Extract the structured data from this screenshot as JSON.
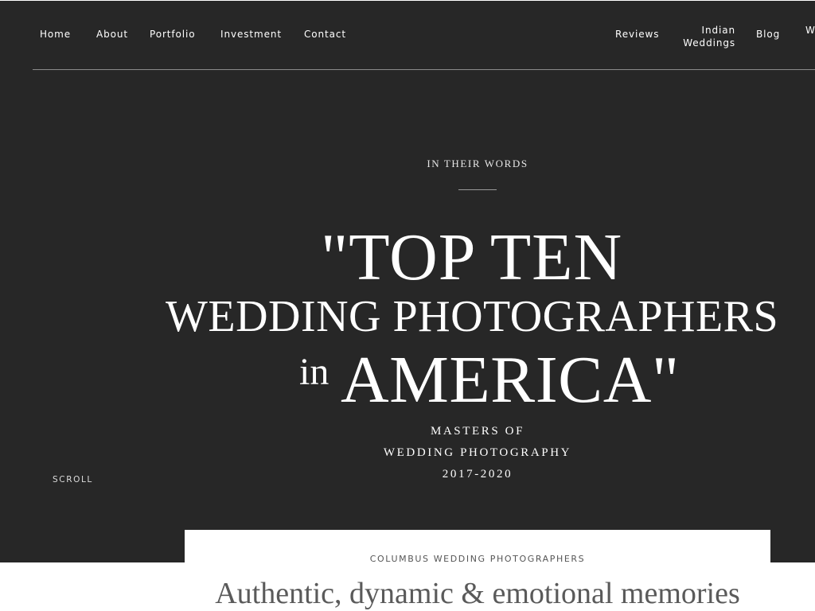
{
  "nav": {
    "home": "Home",
    "about": "About",
    "portfolio": "Portfolio",
    "investment": "Investment",
    "contact": "Contact",
    "reviews": "Reviews",
    "indian_weddings": "Indian Weddings",
    "blog": "Blog",
    "cutoff_item": "W"
  },
  "hero": {
    "eyebrow": "IN THEIR WORDS",
    "headline_line1": "\"TOP TEN",
    "headline_line2": "WEDDING PHOTOGRAPHERS",
    "headline_in": "in",
    "headline_line3": "AMERICA\"",
    "subtitle_line1": "MASTERS OF",
    "subtitle_line2": "WEDDING PHOTOGRAPHY",
    "subtitle_line3": "2017-2020",
    "scroll_label": "SCROLL"
  },
  "card": {
    "eyebrow": "COLUMBUS WEDDING PHOTOGRAPHERS",
    "title": "Authentic, dynamic & emotional memories"
  },
  "colors": {
    "hero_background": "#272727",
    "text_light": "#ffffff",
    "card_title": "#5a5a5a"
  }
}
